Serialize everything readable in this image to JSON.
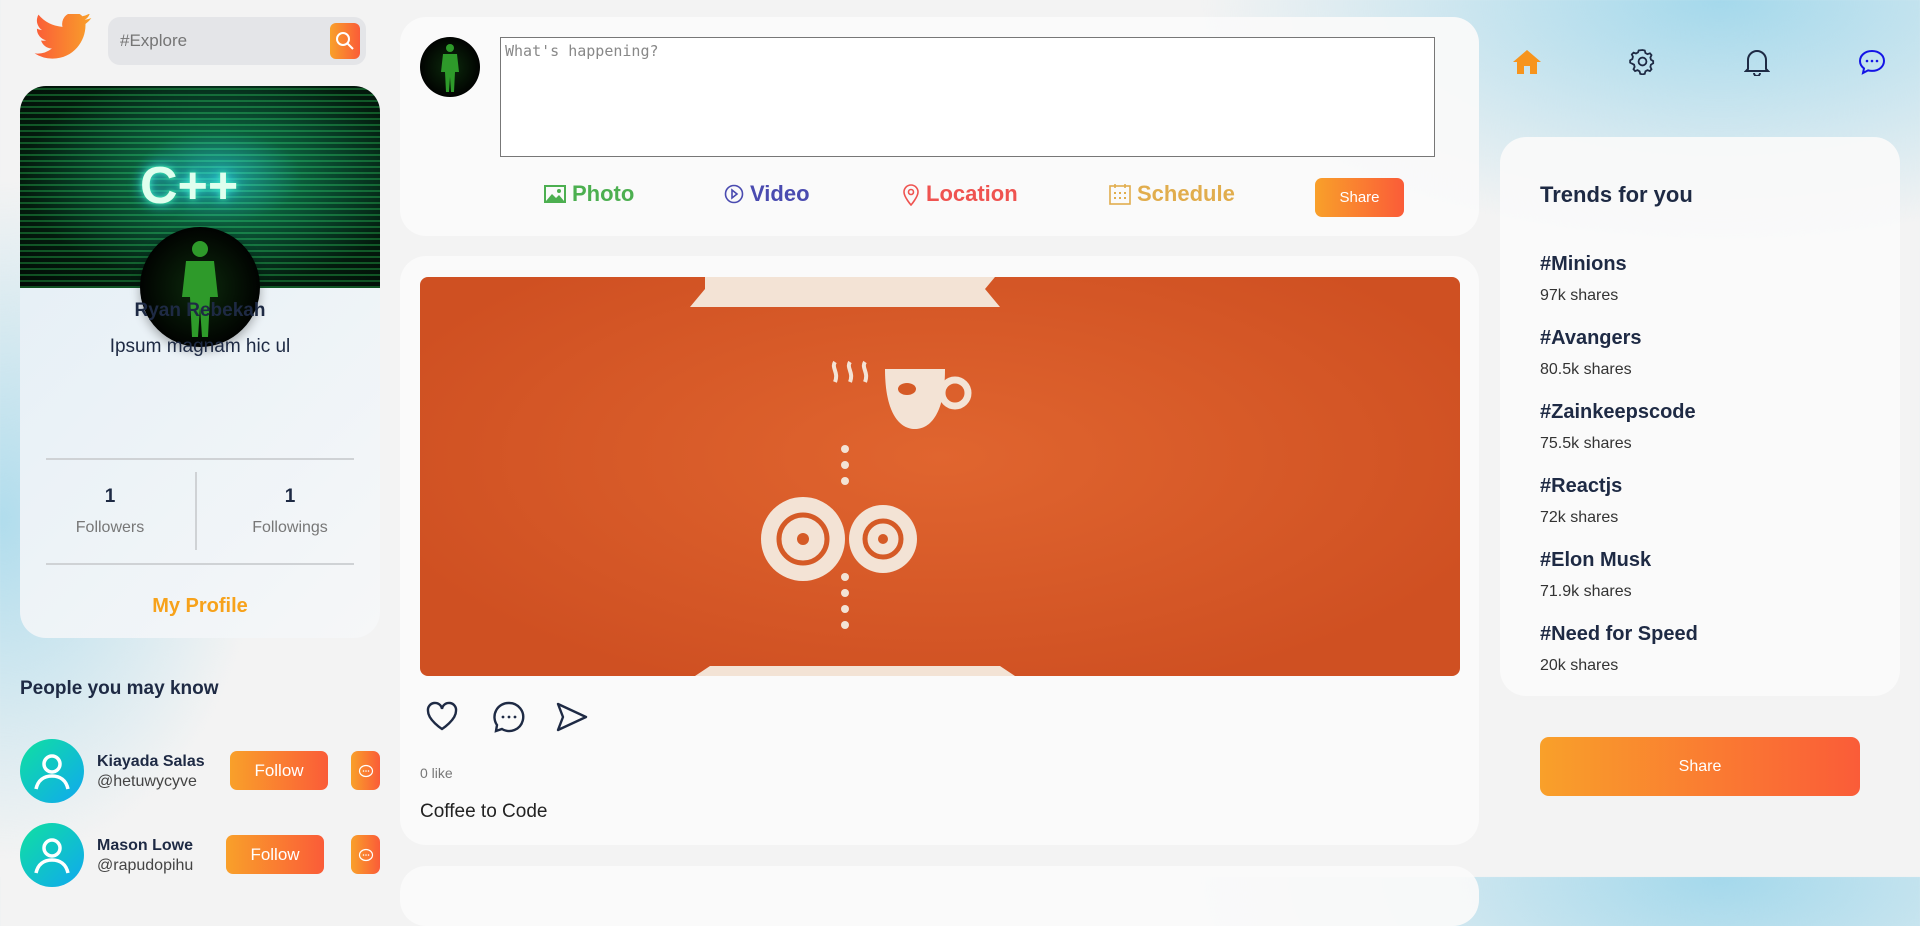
{
  "search": {
    "placeholder": "#Explore"
  },
  "profile": {
    "name": "Ryan Rebekah",
    "bio": "Ipsum magnam hic ul",
    "followers_count": "1",
    "followers_label": "Followers",
    "followings_count": "1",
    "followings_label": "Followings",
    "my_profile_label": "My Profile",
    "cover_text": "C++"
  },
  "people": {
    "title": "People you may know",
    "items": [
      {
        "name": "Kiayada Salas",
        "handle": "@hetuwycyve",
        "follow_label": "Follow"
      },
      {
        "name": "Mason Lowe",
        "handle": "@rapudopihu",
        "follow_label": "Follow"
      }
    ]
  },
  "composer": {
    "placeholder": "What's happening?",
    "actions": [
      {
        "label": "Photo",
        "color": "#4caf50"
      },
      {
        "label": "Video",
        "color": "#4a4bb0"
      },
      {
        "label": "Location",
        "color": "#ef5350"
      },
      {
        "label": "Schedule",
        "color": "#e1ad4d"
      }
    ],
    "share_label": "Share"
  },
  "post": {
    "likes": "0 like",
    "caption": "Coffee to Code"
  },
  "nav": {
    "icons": [
      "home-icon",
      "gear-icon",
      "bell-icon",
      "chat-icon"
    ],
    "active": "home-icon",
    "active_color": "#f7941d"
  },
  "trends": {
    "title": "Trends for you",
    "items": [
      {
        "tag": "#Minions",
        "shares": "97k shares"
      },
      {
        "tag": "#Avangers",
        "shares": "80.5k shares"
      },
      {
        "tag": "#Zainkeepscode",
        "shares": "75.5k shares"
      },
      {
        "tag": "#Reactjs",
        "shares": "72k shares"
      },
      {
        "tag": "#Elon Musk",
        "shares": "71.9k shares"
      },
      {
        "tag": "#Need for Speed",
        "shares": "20k shares"
      }
    ]
  },
  "share_label": "Share",
  "colors": {
    "accent_start": "#f9a02a",
    "accent_end": "#fa5c38",
    "text": "#1e2a44"
  }
}
